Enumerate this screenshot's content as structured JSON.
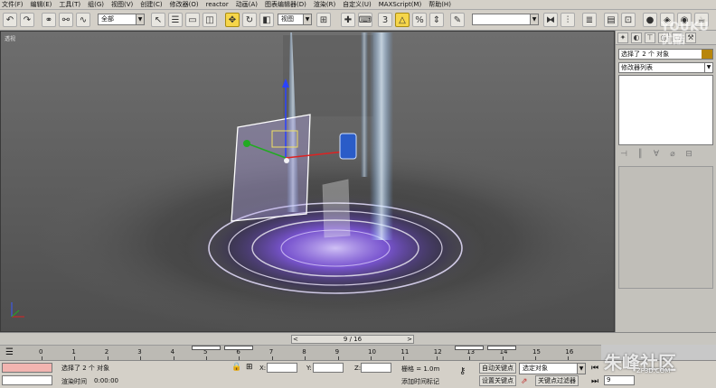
{
  "menu": [
    "文件(F)",
    "编辑(E)",
    "工具(T)",
    "组(G)",
    "视图(V)",
    "创建(C)",
    "修改器(O)",
    "reactor",
    "动画(A)",
    "图表编辑器(D)",
    "渲染(R)",
    "自定义(U)",
    "MAXScript(M)",
    "帮助(H)"
  ],
  "toolbar": {
    "filter_value": "全部",
    "coord_value": "视图",
    "named_sel_value": ""
  },
  "viewport": {
    "label": "透视"
  },
  "panel": {
    "selection_name": "选择了 2 个 对象",
    "modifier_list": "修改器列表"
  },
  "time_slider": {
    "label": "9 / 16",
    "left": "<",
    "right": ">"
  },
  "track": {
    "ticks": [
      "0",
      "1",
      "2",
      "3",
      "4",
      "5",
      "6",
      "7",
      "8",
      "9",
      "10",
      "11",
      "12",
      "13",
      "14",
      "15",
      "16"
    ]
  },
  "status": {
    "selected": "选择了 2 个 对象",
    "render_time_label": "渲染时间",
    "render_time": "0:00:00",
    "x_label": "X:",
    "y_label": "Y:",
    "z_label": "Z:",
    "grid": "栅格 = 1.0m",
    "add_time_tag": "添加时间标记",
    "auto_key": "自动关键点",
    "set_key": "设置关键点",
    "key_filter_value": "选定对象",
    "key_filters": "关键点过滤器",
    "frame": "9"
  },
  "watermark": {
    "youku_1": "YOUKU",
    "youku_2": "优酷",
    "brand": "朱峰社区",
    "site": "ZF3D.COM"
  },
  "colors": {
    "accent": "#f6d64a",
    "magic_glow": "#9b6bff",
    "ui_bg": "#d4d0c8"
  }
}
